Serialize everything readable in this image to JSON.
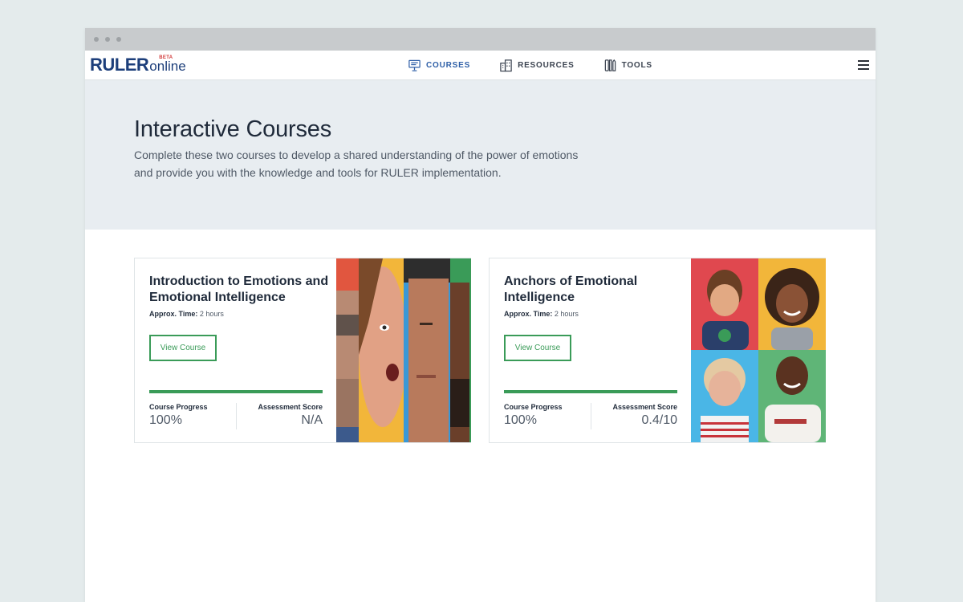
{
  "nav": {
    "logo_main": "RULER",
    "logo_beta": "BETA",
    "logo_sub": "online",
    "links": [
      {
        "label": "COURSES",
        "icon": "presentation-board-icon",
        "active": true
      },
      {
        "label": "RESOURCES",
        "icon": "buildings-icon",
        "active": false
      },
      {
        "label": "TOOLS",
        "icon": "tools-icon",
        "active": false
      }
    ],
    "menu_icon": "hamburger-menu-icon"
  },
  "hero": {
    "title": "Interactive Courses",
    "description": "Complete these two courses to develop a shared understanding of the power of emotions and provide you with the knowledge and tools for RULER implementation."
  },
  "courses": [
    {
      "title": "Introduction to Emotions and Emotional Intelligence",
      "time_label": "Approx. Time:",
      "time_value": "2 hours",
      "button_label": "View Course",
      "progress_label": "Course Progress",
      "progress_value": "100%",
      "progress_fraction": 1.0,
      "score_label": "Assessment Score",
      "score_value": "N/A"
    },
    {
      "title": "Anchors of Emotional Intelligence",
      "time_label": "Approx. Time:",
      "time_value": "2 hours",
      "button_label": "View Course",
      "progress_label": "Course Progress",
      "progress_value": "100%",
      "progress_fraction": 1.0,
      "score_label": "Assessment Score",
      "score_value": "0.4/10"
    }
  ],
  "colors": {
    "brand_navy": "#1c3e7a",
    "accent_green": "#3a9b58",
    "active_nav": "#2e5fa7",
    "hero_bg": "#e8edf1"
  }
}
